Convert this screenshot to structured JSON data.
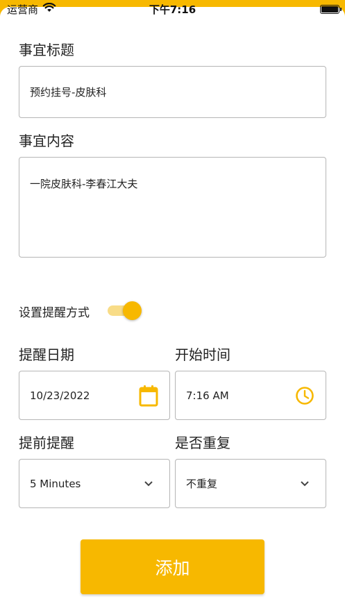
{
  "status_bar": {
    "carrier": "运营商",
    "time": "下午7:16"
  },
  "form": {
    "title_label": "事宜标题",
    "title_value": "预约挂号-皮肤科",
    "content_label": "事宜内容",
    "content_value": "一院皮肤科-李春江大夫",
    "reminder_toggle_label": "设置提醒方式",
    "reminder_enabled": true,
    "date_label": "提醒日期",
    "date_value": "10/23/2022",
    "time_label": "开始时间",
    "time_value": "7:16 AM",
    "advance_label": "提前提醒",
    "advance_value": "5 Minutes",
    "repeat_label": "是否重复",
    "repeat_value": "不重复",
    "add_button": "添加"
  },
  "colors": {
    "accent": "#f7b800",
    "accent_light": "#f8dc87",
    "border": "#b5b5b5"
  }
}
